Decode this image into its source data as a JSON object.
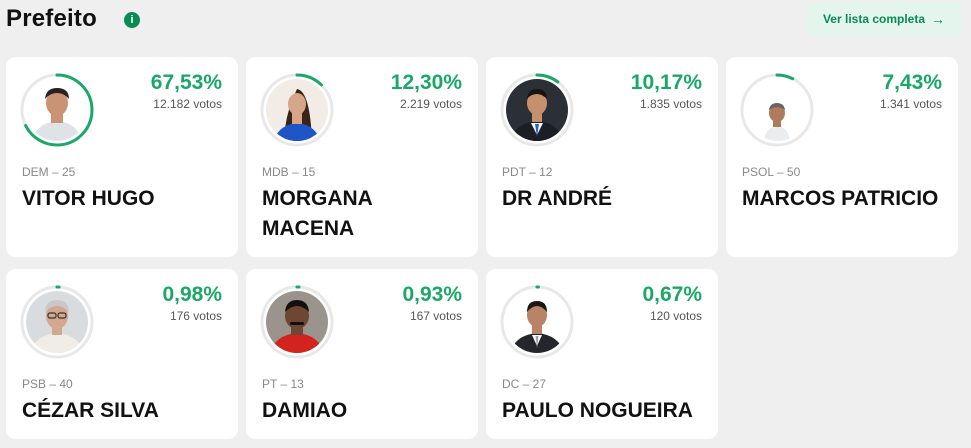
{
  "header": {
    "title": "Prefeito",
    "info_icon": "i",
    "list_button": "Ver lista completa",
    "list_button_arrow": "→"
  },
  "colors": {
    "accent": "#1aa867",
    "ring_track": "#e8e8e8",
    "button_bg": "#e3f5ec",
    "button_text": "#0b8a55"
  },
  "candidates": [
    {
      "percent": "67,53%",
      "share": 0.6753,
      "votes": "12.182 votos",
      "party": "DEM – 25",
      "name": "VITOR HUGO",
      "photo": "photo-man-light-shirt"
    },
    {
      "percent": "12,30%",
      "share": 0.123,
      "votes": "2.219 votos",
      "party": "MDB – 15",
      "name": "MORGANA MACENA",
      "photo": "photo-woman-blue"
    },
    {
      "percent": "10,17%",
      "share": 0.1017,
      "votes": "1.835 votos",
      "party": "PDT – 12",
      "name": "DR ANDRÉ",
      "photo": "photo-man-suit"
    },
    {
      "percent": "7,43%",
      "share": 0.0743,
      "votes": "1.341 votos",
      "party": "PSOL – 50",
      "name": "MARCOS PATRICIO",
      "photo": "photo-man-white-background"
    },
    {
      "percent": "0,98%",
      "share": 0.0098,
      "votes": "176 votos",
      "party": "PSB – 40",
      "name": "CÉZAR SILVA",
      "photo": "photo-man-glasses-gray-hair"
    },
    {
      "percent": "0,93%",
      "share": 0.0093,
      "votes": "167 votos",
      "party": "PT – 13",
      "name": "DAMIAO",
      "photo": "photo-man-red-shirt"
    },
    {
      "percent": "0,67%",
      "share": 0.0067,
      "votes": "120 votos",
      "party": "DC – 27",
      "name": "PAULO NOGUEIRA",
      "photo": "photo-man-dark-suit"
    }
  ]
}
